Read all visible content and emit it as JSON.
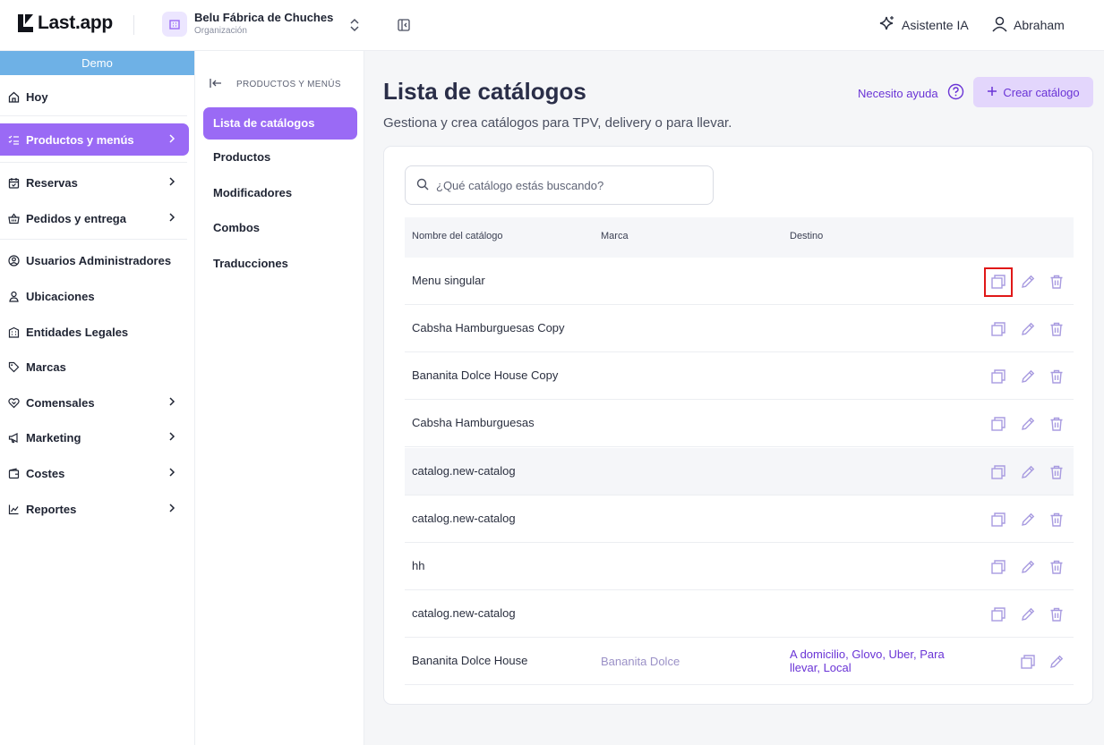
{
  "brand": {
    "name": "Last.app"
  },
  "org": {
    "name": "Belu Fábrica de Chuches",
    "type": "Organización"
  },
  "topbar": {
    "assistant_label": "Asistente IA",
    "user_name": "Abraham"
  },
  "sidebar": {
    "demo_label": "Demo",
    "items": [
      {
        "label": "Hoy",
        "icon": "home-icon"
      },
      {
        "label": "Productos y menús",
        "icon": "list-check-icon",
        "active": true
      },
      {
        "label": "Reservas",
        "icon": "calendar-icon"
      },
      {
        "label": "Pedidos y entrega",
        "icon": "basket-icon"
      },
      {
        "label": "Usuarios Administradores",
        "icon": "user-circle-icon"
      },
      {
        "label": "Ubicaciones",
        "icon": "map-pin-user-icon"
      },
      {
        "label": "Entidades Legales",
        "icon": "building-icon"
      },
      {
        "label": "Marcas",
        "icon": "tag-icon"
      },
      {
        "label": "Comensales",
        "icon": "heart-handshake-icon"
      },
      {
        "label": "Marketing",
        "icon": "megaphone-icon"
      },
      {
        "label": "Costes",
        "icon": "wallet-icon"
      },
      {
        "label": "Reportes",
        "icon": "chart-line-icon"
      }
    ]
  },
  "subnav": {
    "heading": "PRODUCTOS Y MENÚS",
    "items": [
      {
        "label": "Lista de catálogos",
        "active": true
      },
      {
        "label": "Productos"
      },
      {
        "label": "Modificadores"
      },
      {
        "label": "Combos"
      },
      {
        "label": "Traducciones"
      }
    ]
  },
  "main": {
    "title": "Lista de catálogos",
    "subtitle": "Gestiona y crea catálogos para TPV, delivery o para llevar.",
    "help_label": "Necesito ayuda",
    "create_label": "Crear catálogo",
    "search_placeholder": "¿Qué catálogo estás buscando?",
    "columns": [
      "Nombre del catálogo",
      "Marca",
      "Destino"
    ],
    "rows": [
      {
        "name": "Menu singular",
        "brand": "",
        "destination": ""
      },
      {
        "name": "Cabsha Hamburguesas Copy",
        "brand": "",
        "destination": ""
      },
      {
        "name": "Bananita Dolce House Copy",
        "brand": "",
        "destination": ""
      },
      {
        "name": "Cabsha Hamburguesas",
        "brand": "",
        "destination": ""
      },
      {
        "name": "catalog.new-catalog",
        "brand": "",
        "destination": ""
      },
      {
        "name": "catalog.new-catalog",
        "brand": "",
        "destination": ""
      },
      {
        "name": "hh",
        "brand": "",
        "destination": ""
      },
      {
        "name": "catalog.new-catalog",
        "brand": "",
        "destination": ""
      },
      {
        "name": "Bananita Dolce House",
        "brand": "Bananita Dolce",
        "destination": "A domicilio, Glovo, Uber, Para llevar, Local"
      }
    ]
  },
  "colors": {
    "accent": "#9a6af5",
    "accent_text": "#6a34d6",
    "demo_bar": "#6eb1e6",
    "highlight": "#e01818"
  }
}
